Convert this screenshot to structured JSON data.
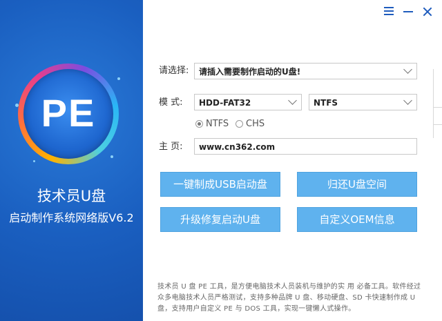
{
  "brand": {
    "logo_text": "PE",
    "title": "技术员U盘",
    "subtitle": "启动制作系统网络版V6.2"
  },
  "form": {
    "select_label": "请选择:",
    "usb_select_value": "请插入需要制作启动的U盘!",
    "mode_label": "模  式:",
    "mode_value": "HDD-FAT32",
    "fs_value": "NTFS",
    "radio_ntfs": "NTFS",
    "radio_chs": "CHS",
    "homepage_label": "主  页:",
    "homepage_value": "www.cn362.com"
  },
  "buttons": {
    "one_click": "一键制成USB启动盘",
    "restore_space": "归还U盘空间",
    "upgrade_repair": "升级修复启动U盘",
    "custom_oem": "自定义OEM信息"
  },
  "footer": {
    "text": "技术员 U 盘 PE 工具，是方便电脑技术人员装机与维护的实 用 必备工具。软件经过众多电脑技术人员严格测试，支持多种品牌 U 盘、移动硬盘、SD 卡快速制作成 U 盘，支持用户自定义 PE 与 DOS 工具，实现一键懒人式操作。"
  },
  "colors": {
    "left_panel": "#1a5fc0",
    "button_bg": "#5fb2ee",
    "window_controls": "#1e5bbd"
  }
}
